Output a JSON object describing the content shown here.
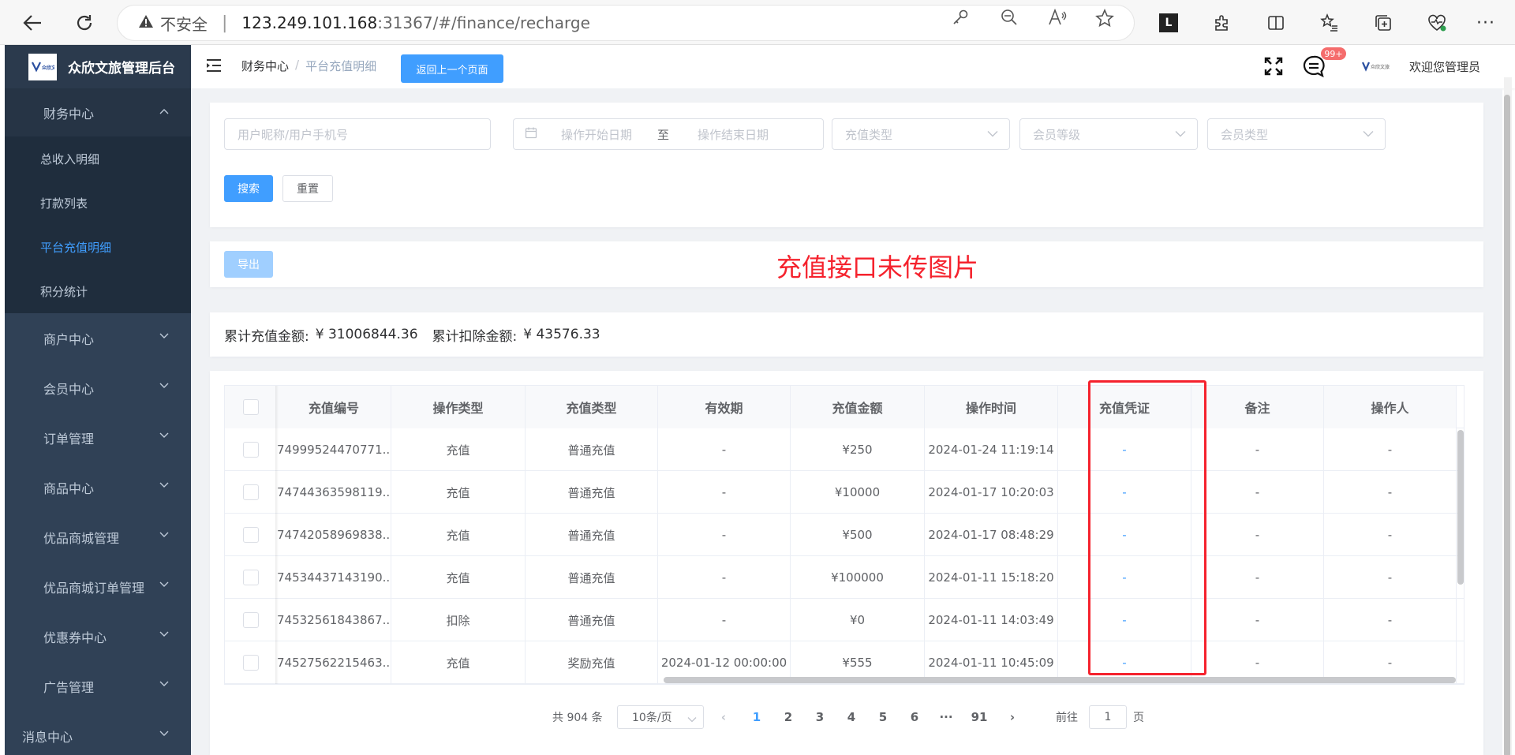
{
  "browser": {
    "insecure_label": "不安全",
    "url_host": "123.249.101.168",
    "url_path": ":31367/#/finance/recharge"
  },
  "sidebar": {
    "logo_text": "众欣文旅管理后台",
    "logo_mark": "众欣文旅",
    "finance": {
      "label": "财务中心",
      "items": [
        "总收入明细",
        "打款列表",
        "平台充值明细",
        "积分统计"
      ]
    },
    "menus": [
      "商户中心",
      "会员中心",
      "订单管理",
      "商品中心",
      "优品商城管理",
      "优品商城订单管理",
      "优惠券中心",
      "广告管理",
      "消息中心"
    ]
  },
  "header": {
    "breadcrumb_root": "财务中心",
    "breadcrumb_sep": "/",
    "breadcrumb_current": "平台充值明细",
    "back_button": "返回上一个页面",
    "badge": "99+",
    "avatar_mark": "众欣文旅",
    "welcome": "欢迎您管理员"
  },
  "filters": {
    "user_placeholder": "用户昵称/用户手机号",
    "start_date_placeholder": "操作开始日期",
    "range_sep": "至",
    "end_date_placeholder": "操作结束日期",
    "recharge_type_placeholder": "充值类型",
    "member_level_placeholder": "会员等级",
    "member_type_placeholder": "会员类型",
    "search_button": "搜索",
    "reset_button": "重置"
  },
  "toolbar": {
    "export_button": "导出",
    "annotation": "充值接口未传图片"
  },
  "summary": {
    "total_recharge_label": "累计充值金额:",
    "total_recharge_value": "¥ 31006844.36",
    "total_deduct_label": "累计扣除金额:",
    "total_deduct_value": "¥ 43576.33"
  },
  "table": {
    "columns": [
      "充值编号",
      "操作类型",
      "充值类型",
      "有效期",
      "充值金额",
      "操作时间",
      "充值凭证",
      "备注",
      "操作人"
    ],
    "rows": [
      [
        "74999524470771...",
        "充值",
        "普通充值",
        "-",
        "¥250",
        "2024-01-24 11:19:14",
        "-",
        "-",
        "-"
      ],
      [
        "74744363598119...",
        "充值",
        "普通充值",
        "-",
        "¥10000",
        "2024-01-17 10:20:03",
        "-",
        "-",
        "-"
      ],
      [
        "74742058969838...",
        "充值",
        "普通充值",
        "-",
        "¥500",
        "2024-01-17 08:48:29",
        "-",
        "-",
        "-"
      ],
      [
        "74534437143190...",
        "充值",
        "普通充值",
        "-",
        "¥100000",
        "2024-01-11 15:18:20",
        "-",
        "-",
        "-"
      ],
      [
        "74532561843867...",
        "扣除",
        "普通充值",
        "-",
        "¥0",
        "2024-01-11 14:03:49",
        "-",
        "-",
        "-"
      ],
      [
        "74527562215463...",
        "充值",
        "奖励充值",
        "2024-01-12 00:00:00",
        "¥555",
        "2024-01-11 10:45:09",
        "-",
        "-",
        "-"
      ]
    ]
  },
  "pagination": {
    "total": "共 904 条",
    "page_size": "10条/页",
    "prev": "‹",
    "pages": [
      "1",
      "2",
      "3",
      "4",
      "5",
      "6",
      "···",
      "91"
    ],
    "next": "›",
    "goto_label": "前往",
    "goto_value": "1",
    "goto_suffix": "页",
    "current": "1"
  },
  "colors": {
    "sidebar_bg": "#304156",
    "sidebar_sub_bg": "#1f2d3d",
    "primary": "#409eff",
    "annotation_red": "#f5222d"
  }
}
